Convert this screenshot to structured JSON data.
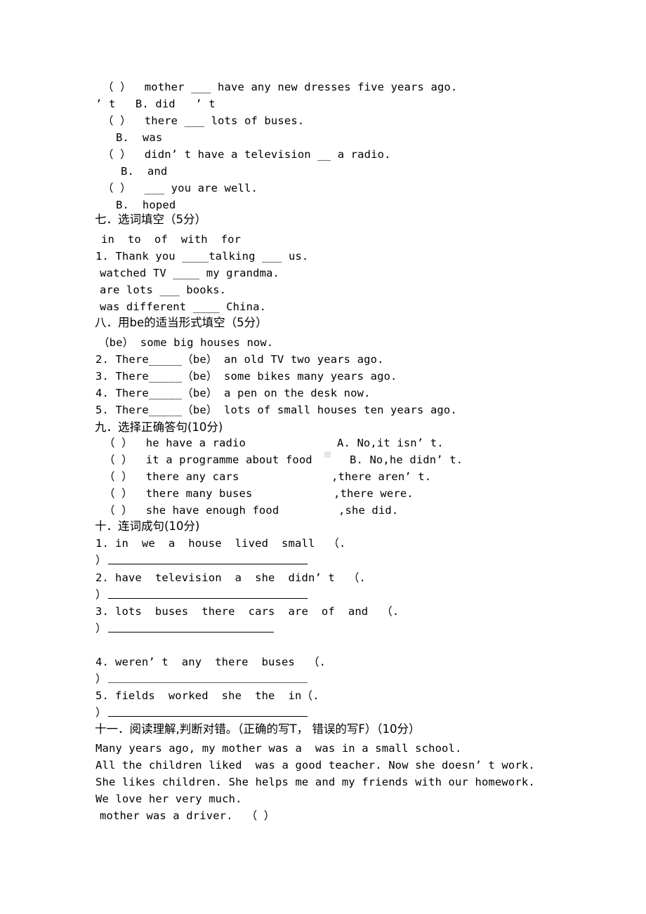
{
  "document": {
    "kind": "english-exam-paper",
    "language": "zh-CN + en"
  },
  "section_six_tail": {
    "lines": [
      {
        "text": "（ ）  mother ___ have any new dresses five years ago."
      },
      {
        "text": "’ t   B. did   ’ t"
      },
      {
        "text": "（ ）  there ___ lots of buses."
      },
      {
        "text": "B.  was"
      },
      {
        "text": "（ ）  didn’ t have a television __ a radio."
      },
      {
        "text": "B.  and"
      },
      {
        "text": "（ ）  ___ you are well."
      },
      {
        "text": "B.  hoped"
      }
    ]
  },
  "section_seven": {
    "heading": "七．选词填空（5分）",
    "word_bank": "in  to  of  with  for",
    "items": [
      "1. Thank you ____talking ___ us.",
      "watched TV ____ my grandma.",
      "are lots ___ books.",
      "was different ____ China."
    ]
  },
  "section_eight": {
    "heading": "八．用be的适当形式填空（5分）",
    "items": [
      "（be） some big houses now.",
      "2. There_____（be） an old TV two years ago.",
      "3. There_____（be） some bikes many years ago.",
      "4. There_____（be） a pen on the desk now.",
      "5. There_____（be） lots of small houses ten years ago."
    ]
  },
  "section_nine": {
    "heading": "九．选择正确答句(10分)",
    "rows": [
      {
        "left": "（ ）  he have a radio",
        "right": "A. No,it isn’ t."
      },
      {
        "left": "（ ）  it a programme about food",
        "right": "B. No,he didn’ t."
      },
      {
        "left": "（ ）  there any cars",
        "right": ",there aren’ t."
      },
      {
        "left": "（ ）  there many buses",
        "right": ",there were."
      },
      {
        "left": "（ ）  she have enough food",
        "right": ",she did."
      }
    ]
  },
  "section_ten": {
    "heading": "十．连词成句(10分)",
    "items": [
      {
        "number": "1.",
        "words": "in  we  a  house  lived  small  （.",
        "close": "）"
      },
      {
        "number": "2.",
        "words": "have  television  a  she  didn’ t  （.",
        "close": "）"
      },
      {
        "number": "3.",
        "words": "lots  buses  there  cars  are  of  and  （.",
        "close": "）"
      },
      {
        "number": "4.",
        "words": "weren’ t  any  there  buses  （.",
        "close": "）"
      },
      {
        "number": "5.",
        "words": "fields  worked  she  the  in（.",
        "close": "）"
      }
    ]
  },
  "section_eleven": {
    "heading": "十一．阅读理解,判断对错。（正确的写T， 错误的写F）（10分）",
    "passage": [
      "Many years ago, my mother was a  was in a small school.",
      "All the children liked  was a good teacher. Now she doesn’ t work.",
      "She likes children. She helps me and my friends with our homework.",
      "We love her very much."
    ],
    "statements": [
      "mother was a driver.  （ ）"
    ]
  }
}
